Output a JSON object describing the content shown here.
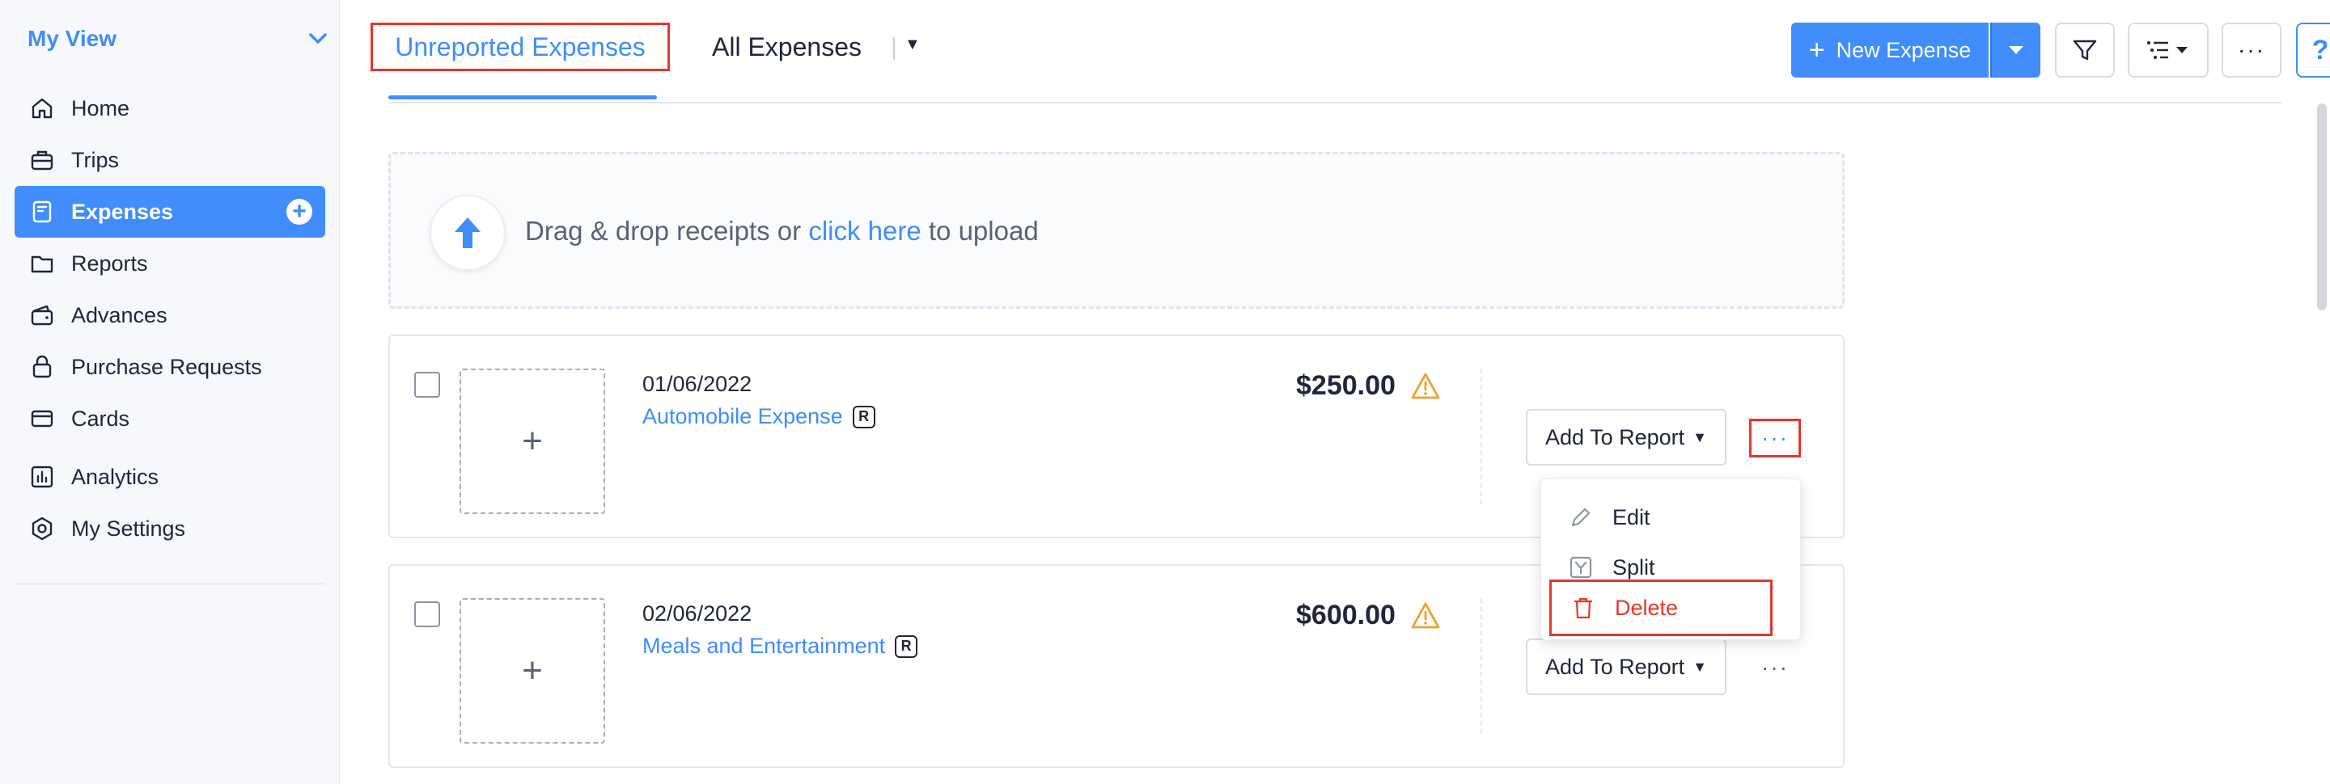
{
  "sidebar": {
    "view_label": "My View",
    "items": [
      {
        "label": "Home",
        "icon": "home-icon"
      },
      {
        "label": "Trips",
        "icon": "suitcase-icon"
      },
      {
        "label": "Expenses",
        "icon": "receipt-icon",
        "active": true
      },
      {
        "label": "Reports",
        "icon": "folder-icon"
      },
      {
        "label": "Advances",
        "icon": "wallet-icon"
      },
      {
        "label": "Purchase Requests",
        "icon": "lock-bag-icon"
      },
      {
        "label": "Cards",
        "icon": "card-icon"
      },
      {
        "label": "Analytics",
        "icon": "bar-chart-icon"
      },
      {
        "label": "My Settings",
        "icon": "gear-icon"
      }
    ]
  },
  "header": {
    "tabs": [
      {
        "label": "Unreported Expenses",
        "active": true
      },
      {
        "label": "All Expenses",
        "active": false
      }
    ],
    "new_expense_label": "New Expense",
    "help_label": "?"
  },
  "upload": {
    "text_before": "Drag & drop receipts or",
    "link_text": "click here",
    "text_after": "to upload"
  },
  "expenses": [
    {
      "date": "01/06/2022",
      "category": "Automobile Expense",
      "badge": "R",
      "amount": "$250.00",
      "action_label": "Add To Report"
    },
    {
      "date": "02/06/2022",
      "category": "Meals and Entertainment",
      "badge": "R",
      "amount": "$600.00",
      "action_label": "Add To Report"
    }
  ],
  "row_menu": {
    "items": [
      {
        "label": "Edit",
        "icon": "pencil-icon"
      },
      {
        "label": "Split",
        "icon": "split-icon"
      },
      {
        "label": "Delete",
        "icon": "trash-icon"
      }
    ]
  },
  "colors": {
    "accent": "#408dfb",
    "highlight": "#e8362a",
    "warning": "#f0a030",
    "sidebar_bg": "#f7f8fc"
  }
}
